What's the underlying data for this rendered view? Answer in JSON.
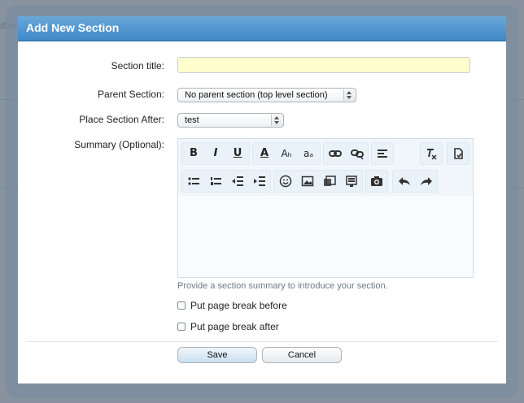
{
  "background": {
    "fragment_text": "docu"
  },
  "dialog": {
    "title": "Add New Section",
    "section_title_label": "Section title:",
    "section_title_value": "",
    "parent_section_label": "Parent Section:",
    "parent_section_value": "No parent section (top level section)",
    "place_after_label": "Place Section After:",
    "place_after_value": "test",
    "summary_label": "Summary (Optional):",
    "summary_hint": "Provide a section summary to introduce your section.",
    "page_break_before_label": "Put page break before",
    "page_break_before_checked": false,
    "page_break_after_label": "Put page break after",
    "page_break_after_checked": false,
    "save_label": "Save",
    "cancel_label": "Cancel"
  },
  "toolbar": {
    "bold": "B",
    "italic": "I",
    "underline": "U",
    "text_color": "A",
    "font_size": "Aₕ",
    "font_family": "aₐ",
    "row1_icons": [
      "bold-icon",
      "italic-icon",
      "underline-icon",
      "text-color-icon",
      "font-size-icon",
      "font-family-icon",
      "link-icon",
      "unlink-icon",
      "align-icon",
      "clear-format-icon",
      "paste-icon"
    ],
    "row2_icons": [
      "bullet-list-icon",
      "numbered-list-icon",
      "outdent-icon",
      "indent-icon",
      "smiley-icon",
      "image-icon",
      "media-icon",
      "template-icon",
      "camera-icon",
      "undo-icon",
      "redo-icon"
    ]
  },
  "colors": {
    "title_bar": "#4a90cc",
    "title_input_bg": "#fffecd",
    "save_button": "#c9dff1"
  }
}
